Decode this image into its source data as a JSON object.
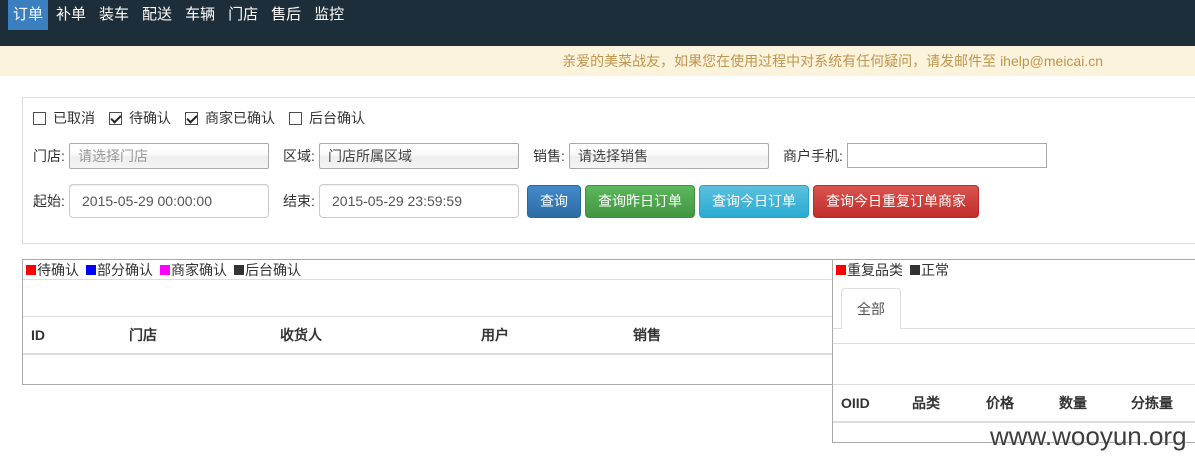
{
  "theme": {
    "navbar_bg": "#1e2d3a",
    "nav_active_bg": "#3b7fc1",
    "notice_bg": "#fcf3dc",
    "notice_text": "#c0954e"
  },
  "nav": {
    "items": [
      {
        "label": "订单",
        "active": true
      },
      {
        "label": "补单",
        "active": false
      },
      {
        "label": "装车",
        "active": false
      },
      {
        "label": "配送",
        "active": false
      },
      {
        "label": "车辆",
        "active": false
      },
      {
        "label": "门店",
        "active": false
      },
      {
        "label": "售后",
        "active": false
      },
      {
        "label": "监控",
        "active": false
      }
    ]
  },
  "notice": {
    "text": "亲爱的美菜战友，如果您在使用过程中对系统有任何疑问，请发邮件至 ihelp@meicai.cn"
  },
  "filters": {
    "status_options": [
      {
        "label": "已取消",
        "checked": false
      },
      {
        "label": "待确认",
        "checked": true
      },
      {
        "label": "商家已确认",
        "checked": true
      },
      {
        "label": "后台确认",
        "checked": false
      }
    ],
    "store": {
      "label": "门店:",
      "placeholder": "请选择门店"
    },
    "area": {
      "label": "区域:",
      "value": "门店所属区域"
    },
    "sales": {
      "label": "销售:",
      "value": "请选择销售"
    },
    "merchant_phone": {
      "label": "商户手机:"
    },
    "start_time": {
      "label": "起始:",
      "value": "2015-05-29 00:00:00"
    },
    "end_time": {
      "label": "结束:",
      "value": "2015-05-29 23:59:59"
    },
    "buttons": {
      "query": "查询",
      "query_yesterday": "查询昨日订单",
      "query_today": "查询今日订单",
      "query_today_duplicate": "查询今日重复订单商家"
    }
  },
  "orders_table": {
    "legend": [
      {
        "label": "待确认",
        "color": "#ff0000"
      },
      {
        "label": "部分确认",
        "color": "#0000ff"
      },
      {
        "label": "商家确认",
        "color": "#ff00ff"
      },
      {
        "label": "后台确认",
        "color": "#333333"
      }
    ],
    "columns": [
      "ID",
      "门店",
      "收货人",
      "用户",
      "销售"
    ]
  },
  "items_table": {
    "legend": [
      {
        "label": "重复品类",
        "color": "#ff0000"
      },
      {
        "label": "正常",
        "color": "#333333"
      }
    ],
    "tabs": [
      {
        "label": "全部",
        "active": true
      }
    ],
    "columns": [
      "OIID",
      "品类",
      "价格",
      "数量",
      "分拣量"
    ]
  },
  "watermark": "www.wooyun.org"
}
